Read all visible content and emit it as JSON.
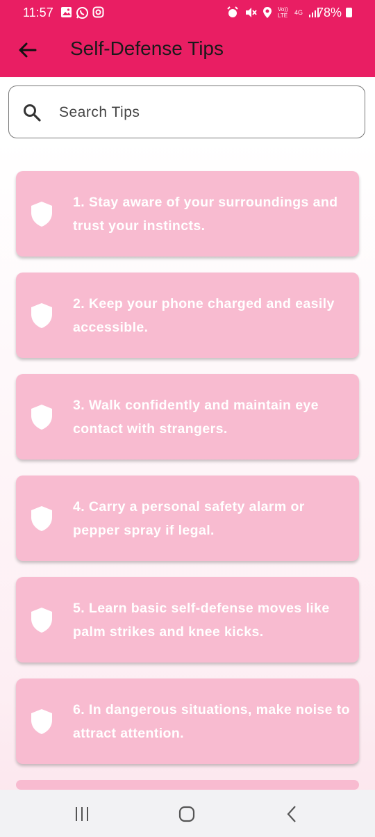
{
  "status_bar": {
    "time": "11:57",
    "battery": "78%",
    "network": "4G",
    "carrier": "Vo)) LTE"
  },
  "header": {
    "title": "Self-Defense Tips",
    "back_icon": "arrow-left-icon",
    "accent_color": "#e91e63"
  },
  "search": {
    "placeholder": "Search Tips",
    "value": ""
  },
  "tips": [
    {
      "text": "1. Stay aware of your surroundings and trust your instincts."
    },
    {
      "text": "2. Keep your phone charged and easily accessible."
    },
    {
      "text": "3. Walk confidently and maintain eye contact with strangers."
    },
    {
      "text": "4. Carry a personal safety alarm or pepper spray if legal."
    },
    {
      "text": "5. Learn basic self-defense moves like palm strikes and knee kicks."
    },
    {
      "text": "6. In dangerous situations, make noise to attract attention."
    }
  ],
  "card_color": "#f8bbd0",
  "nav_bar": {
    "recents_icon": "recents-icon",
    "home_icon": "home-icon",
    "back_icon": "back-chevron-icon"
  }
}
